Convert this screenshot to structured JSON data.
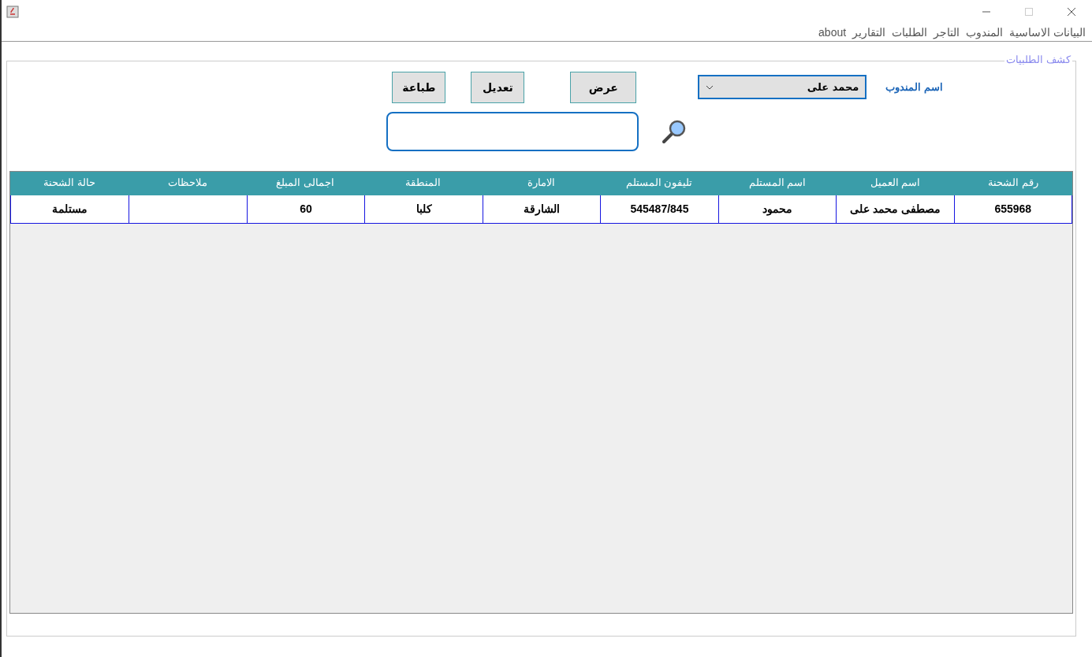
{
  "menu": [
    "البيانات الاساسية",
    "المندوب",
    "التاجر",
    "الطلبات",
    "التقارير",
    "about"
  ],
  "panel_title": "كشف الطلبيات",
  "agent": {
    "label": "اسم المندوب",
    "value": "محمد على"
  },
  "buttons": [
    "عرض",
    "تعديل",
    "طباعة"
  ],
  "table": {
    "columns": [
      "رقم الشحنة",
      "اسم العميل",
      "اسم المستلم",
      "تليفون المستلم",
      "الامارة",
      "المنطقة",
      "اجمالى المبلغ",
      "ملاحظات",
      "حالة الشحنة"
    ],
    "rows": [
      [
        "655968",
        "مصطفى محمد على",
        "محمود",
        "545487/845",
        "الشارقة",
        "كلبا",
        "60",
        "",
        "مستلمة"
      ]
    ]
  }
}
